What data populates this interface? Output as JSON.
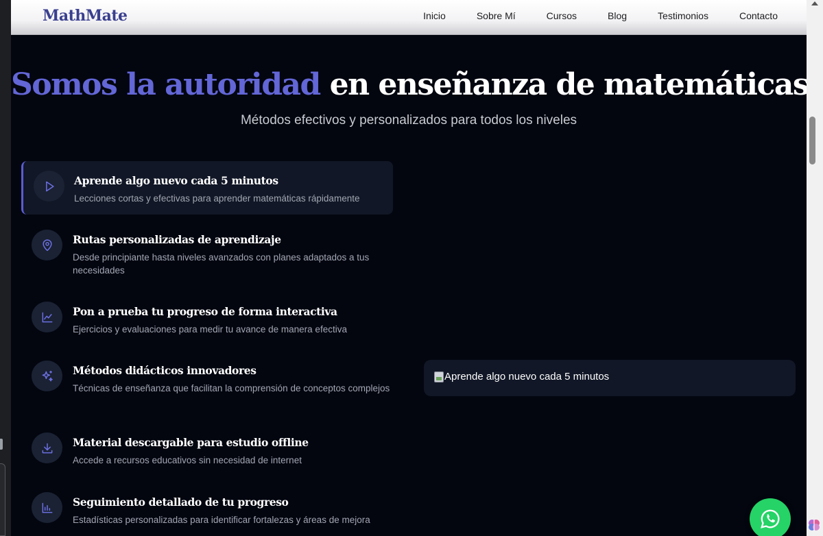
{
  "header": {
    "brand": "MathMate",
    "nav": [
      "Inicio",
      "Sobre Mí",
      "Cursos",
      "Blog",
      "Testimonios",
      "Contacto"
    ]
  },
  "hero": {
    "title_accent": "Somos la autoridad",
    "title_rest": " en enseñanza de matemáticas",
    "subtitle": "Métodos efectivos y personalizados para todos los niveles"
  },
  "features": [
    {
      "icon": "play-icon",
      "title": "Aprende algo nuevo cada 5 minutos",
      "desc": "Lecciones cortas y efectivas para aprender matemáticas rápidamente",
      "active": true
    },
    {
      "icon": "map-pin-icon",
      "title": "Rutas personalizadas de aprendizaje",
      "desc": "Desde principiante hasta niveles avanzados con planes adaptados a tus necesidades"
    },
    {
      "icon": "chart-line-icon",
      "title": "Pon a prueba tu progreso de forma interactiva",
      "desc": "Ejercicios y evaluaciones para medir tu avance de manera efectiva"
    },
    {
      "icon": "sparkles-icon",
      "title": "Métodos didácticos innovadores",
      "desc": "Técnicas de enseñanza que facilitan la comprensión de conceptos complejos"
    },
    {
      "icon": "download-icon",
      "title": "Material descargable para estudio offline",
      "desc": "Accede a recursos educativos sin necesidad de internet"
    },
    {
      "icon": "bar-chart-icon",
      "title": "Seguimiento detallado de tu progreso",
      "desc": "Estadísticas personalizadas para identificar fortalezas y áreas de mejora"
    }
  ],
  "preview": {
    "alt_text": "Aprende algo nuevo cada 5 minutos"
  },
  "colors": {
    "accent": "#6366d6",
    "background": "#03060f",
    "card": "#111726",
    "whatsapp": "#25d366"
  }
}
